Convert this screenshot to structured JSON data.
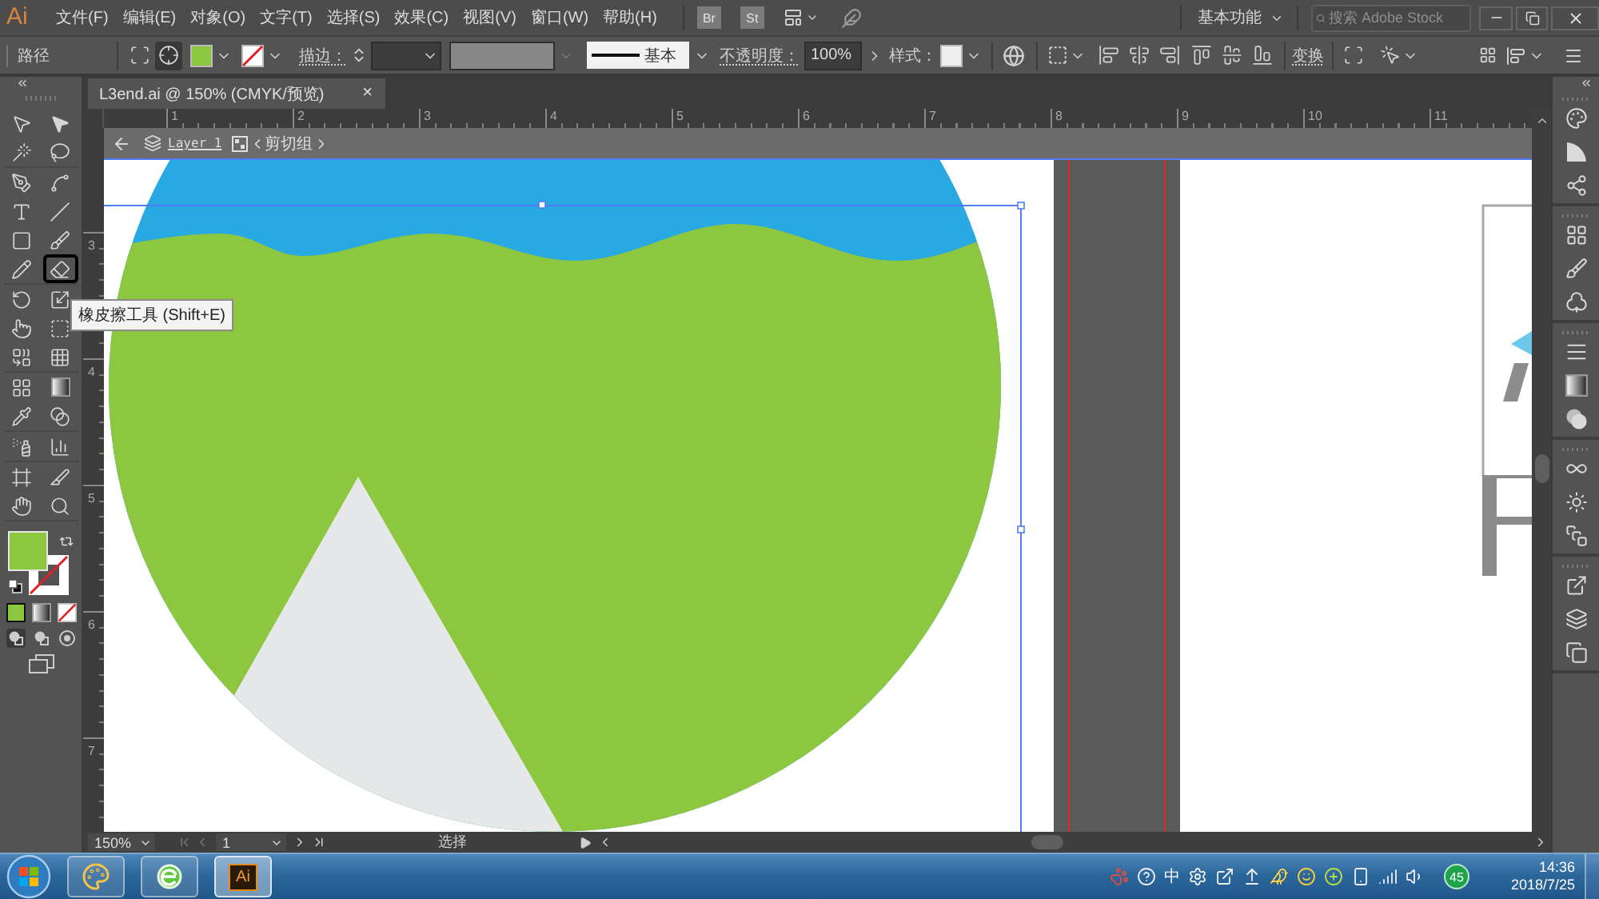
{
  "menu_bar": {
    "logo": "Ai",
    "menus": [
      "文件(F)",
      "编辑(E)",
      "对象(O)",
      "文字(T)",
      "选择(S)",
      "效果(C)",
      "视图(V)",
      "窗口(W)",
      "帮助(H)"
    ],
    "bridge_buttons": [
      "Br",
      "St"
    ],
    "workspace": "基本功能",
    "search": {
      "placeholder": "搜索 Adobe Stock"
    }
  },
  "control_bar": {
    "selection_type": "路径",
    "stroke_label": "描边：",
    "stroke_profile": "基本",
    "opacity_label": "不透明度：",
    "opacity": "100%",
    "style_label": "样式：",
    "transform_button": "变换"
  },
  "document_tab": {
    "title": "L3end.ai @ 150% (CMYK/预览)",
    "close": "×"
  },
  "rulers": {
    "horizontal": [
      "1",
      "2",
      "3",
      "4",
      "5",
      "6",
      "7",
      "8",
      "9",
      "10",
      "11"
    ],
    "vertical": [
      "3",
      "4",
      "5",
      "6",
      "7"
    ]
  },
  "isolation_bar": {
    "layer": "Layer 1",
    "group": "剪切组"
  },
  "tools": [
    {
      "kind": "selection",
      "selected": false
    },
    {
      "kind": "direct-selection",
      "selected": false
    },
    {
      "kind": "magic-wand",
      "selected": false
    },
    {
      "kind": "lasso",
      "selected": false
    },
    {
      "kind": "pen",
      "selected": false
    },
    {
      "kind": "curvature",
      "selected": false
    },
    {
      "kind": "type",
      "selected": false
    },
    {
      "kind": "line",
      "selected": false
    },
    {
      "kind": "rectangle",
      "selected": false
    },
    {
      "kind": "paintbrush",
      "selected": false
    },
    {
      "kind": "shaper",
      "selected": false
    },
    {
      "kind": "eraser",
      "selected": true
    },
    {
      "kind": "rotate",
      "selected": false
    },
    {
      "kind": "scale",
      "selected": false
    },
    {
      "kind": "warp",
      "selected": false
    },
    {
      "kind": "free-transform",
      "selected": false
    },
    {
      "kind": "shape-builder",
      "selected": false
    },
    {
      "kind": "perspective-grid",
      "selected": false
    },
    {
      "kind": "mesh",
      "selected": false
    },
    {
      "kind": "gradient",
      "selected": false
    },
    {
      "kind": "eyedropper",
      "selected": false
    },
    {
      "kind": "blend",
      "selected": false
    },
    {
      "kind": "symbol-sprayer",
      "selected": false
    },
    {
      "kind": "column-graph",
      "selected": false
    },
    {
      "kind": "artboard",
      "selected": false
    },
    {
      "kind": "slice",
      "selected": false
    },
    {
      "kind": "hand",
      "selected": false
    },
    {
      "kind": "zoom",
      "selected": false
    }
  ],
  "tooltip": "橡皮擦工具 (Shift+E)",
  "status_bar": {
    "zoom": "150%",
    "artboard": "1",
    "current_tool": "选择"
  },
  "taskbar": {
    "apps": [
      {
        "kind": "paint",
        "selected": false
      },
      {
        "kind": "browser",
        "selected": false
      },
      {
        "kind": "illustrator",
        "label": "Ai",
        "selected": true
      }
    ],
    "tray": {
      "input_method": "中",
      "badge": "45"
    },
    "clock": {
      "time": "14:36",
      "date": "2018/7/25"
    }
  }
}
